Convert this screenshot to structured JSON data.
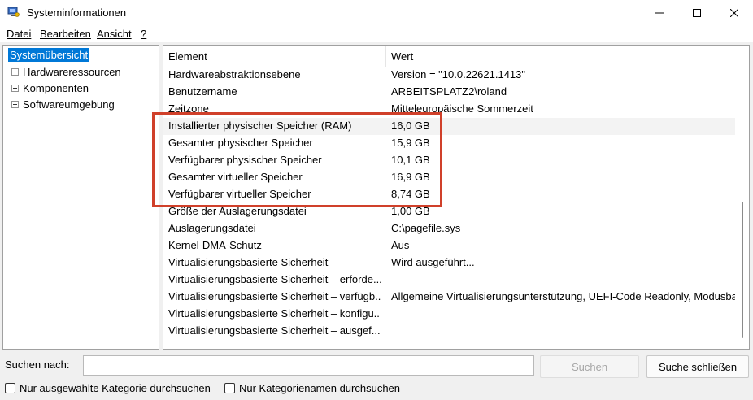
{
  "window": {
    "title": "Systeminformationen"
  },
  "menu": {
    "items": [
      "Datei",
      "Bearbeiten",
      "Ansicht",
      "?"
    ]
  },
  "tree": {
    "root": "Systemübersicht",
    "items": [
      "Hardwareressourcen",
      "Komponenten",
      "Softwareumgebung"
    ]
  },
  "list": {
    "columns": [
      "Element",
      "Wert"
    ],
    "rows": [
      {
        "element": "Hardwareabstraktionsebene",
        "value": "Version = \"10.0.22621.1413\""
      },
      {
        "element": "Benutzername",
        "value": "ARBEITSPLATZ2\\roland"
      },
      {
        "element": "Zeitzone",
        "value": "Mitteleuropäische Sommerzeit"
      },
      {
        "element": "Installierter physischer Speicher (RAM)",
        "value": "16,0 GB"
      },
      {
        "element": "Gesamter physischer Speicher",
        "value": "15,9 GB"
      },
      {
        "element": "Verfügbarer physischer Speicher",
        "value": "10,1 GB"
      },
      {
        "element": "Gesamter virtueller Speicher",
        "value": "16,9 GB"
      },
      {
        "element": "Verfügbarer virtueller Speicher",
        "value": "8,74 GB"
      },
      {
        "element": "Größe der Auslagerungsdatei",
        "value": "1,00 GB"
      },
      {
        "element": "Auslagerungsdatei",
        "value": "C:\\pagefile.sys"
      },
      {
        "element": "Kernel-DMA-Schutz",
        "value": "Aus"
      },
      {
        "element": "Virtualisierungsbasierte Sicherheit",
        "value": "Wird ausgeführt..."
      },
      {
        "element": "Virtualisierungsbasierte Sicherheit – erforde...",
        "value": ""
      },
      {
        "element": "Virtualisierungsbasierte Sicherheit – verfügb...",
        "value": "Allgemeine Virtualisierungsunterstützung, UEFI-Code Readonly, Modusba"
      },
      {
        "element": "Virtualisierungsbasierte Sicherheit – konfigu...",
        "value": ""
      },
      {
        "element": "Virtualisierungsbasierte Sicherheit – ausgef...",
        "value": ""
      }
    ],
    "highlight_color": "#d0402a"
  },
  "search": {
    "label": "Suchen nach:",
    "value": "",
    "search_button": "Suchen",
    "close_button": "Suche schließen",
    "option_selected_category": "Nur ausgewählte Kategorie durchsuchen",
    "option_category_names": "Nur Kategorienamen durchsuchen"
  },
  "icons": {
    "app": "system-info-icon",
    "minimize": "minimize-icon",
    "maximize": "maximize-icon",
    "close": "close-icon"
  }
}
